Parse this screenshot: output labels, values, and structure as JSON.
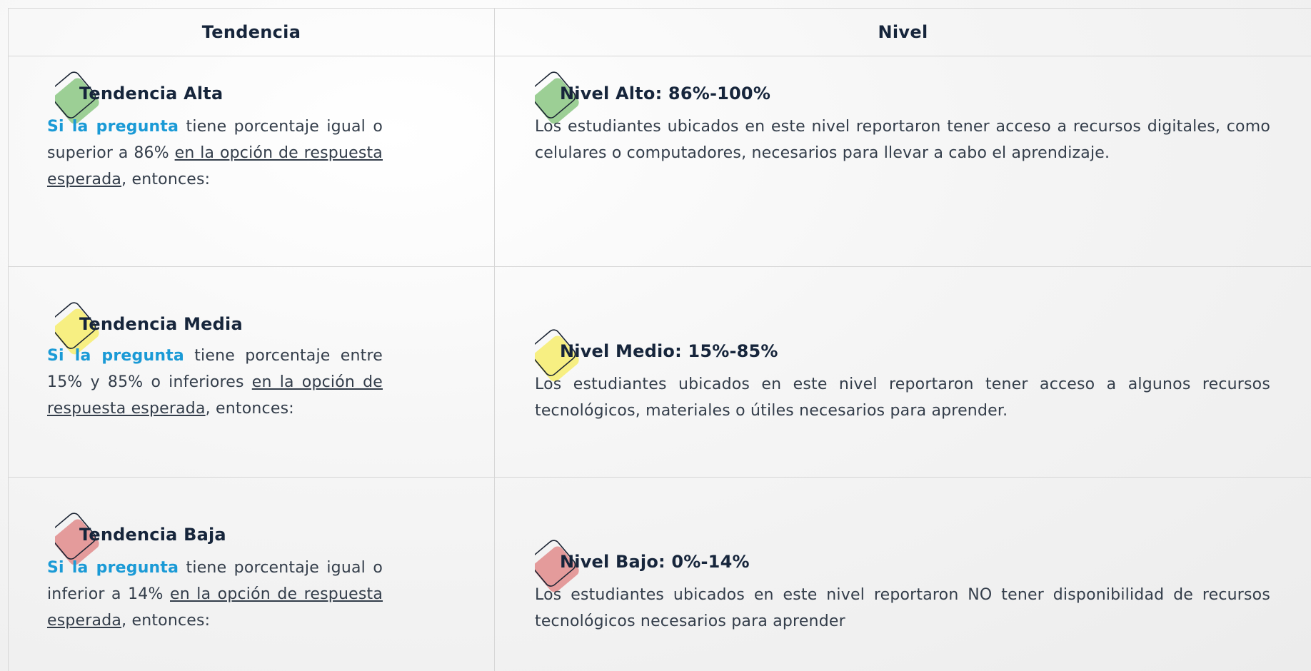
{
  "header": {
    "col1": "Tendencia",
    "col2": "Nivel"
  },
  "colors": {
    "alta": "#9ccf95",
    "media": "#f7ef82",
    "baja": "#e49b9b",
    "lead_text": "#1a9ad6",
    "border": "#d6d6d6"
  },
  "rows": [
    {
      "tendencia": {
        "title": "Tendencia Alta",
        "lead": "Si la pregunta",
        "text1": " tiene porcentaje igual o superior a 86% ",
        "link": "en la opción de respuesta esperada",
        "text2": ", entonces:"
      },
      "nivel": {
        "title": "Nivel Alto: 86%-100%",
        "text": "Los estudiantes ubicados en este nivel reportaron tener acceso a recursos digitales, como celulares o computadores, necesarios para llevar a cabo el aprendizaje."
      }
    },
    {
      "tendencia": {
        "title": "Tendencia Media",
        "lead": "Si la pregunta",
        "text1": " tiene porcentaje entre 15% y 85% o inferiores ",
        "link": "en la opción de respuesta esperada",
        "text2": ", entonces:"
      },
      "nivel": {
        "title": "Nivel Medio: 15%-85%",
        "text": "Los estudiantes ubicados en este nivel reportaron tener acceso a algunos recursos tecnológicos, materiales o útiles necesarios para aprender."
      }
    },
    {
      "tendencia": {
        "title": "Tendencia Baja",
        "lead": "Si la pregunta",
        "text1": " tiene porcentaje igual o inferior a 14% ",
        "link": "en la opción de respuesta esperada",
        "text2": ", entonces:"
      },
      "nivel": {
        "title": "Nivel Bajo: 0%-14%",
        "text": "Los estudiantes ubicados en este nivel reportaron NO tener disponibilidad de recursos tecnológicos necesarios para aprender"
      }
    }
  ]
}
